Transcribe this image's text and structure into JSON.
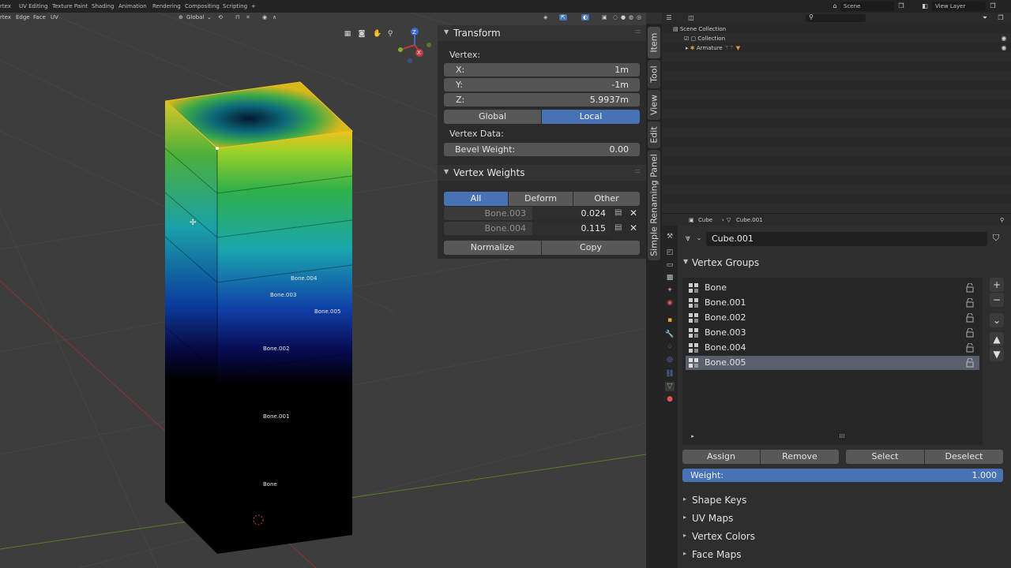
{
  "topbar": {
    "workspaces": [
      "rtex",
      "UV Editing",
      "Texture Paint",
      "Shading",
      "Animation",
      "Rendering",
      "Compositing",
      "Scripting",
      "+"
    ],
    "scene": "Scene",
    "view_layer": "View Layer"
  },
  "viewport_header": {
    "menus": [
      "rtex",
      "Edge",
      "Face",
      "UV"
    ],
    "orientation": "Global"
  },
  "gizmo": {
    "x": "X",
    "y": "Y",
    "z": "Z"
  },
  "bone_labels": [
    "Bone.004",
    "Bone.003",
    "Bone.005",
    "Bone.002",
    "Bone.001",
    "Bone"
  ],
  "transform": {
    "title": "Transform",
    "vertex_label": "Vertex:",
    "x_label": "X:",
    "x_value": "1m",
    "y_label": "Y:",
    "y_value": "-1m",
    "z_label": "Z:",
    "z_value": "5.9937m",
    "global": "Global",
    "local": "Local",
    "vertex_data_label": "Vertex Data:",
    "bevel_label": "Bevel Weight:",
    "bevel_value": "0.00"
  },
  "vertex_weights": {
    "title": "Vertex Weights",
    "tabs": [
      "All",
      "Deform",
      "Other"
    ],
    "rows": [
      {
        "bone": "Bone.003",
        "value": "0.024"
      },
      {
        "bone": "Bone.004",
        "value": "0.115"
      }
    ],
    "normalize": "Normalize",
    "copy": "Copy"
  },
  "side_tabs": [
    "Item",
    "Tool",
    "View",
    "Edit",
    "Simple Renaming Panel"
  ],
  "outliner": {
    "scene_collection": "Scene Collection",
    "collection": "Collection",
    "armature": "Armature"
  },
  "properties": {
    "breadcrumb_object": "Cube",
    "breadcrumb_data": "Cube.001",
    "mesh_name": "Cube.001",
    "vertex_groups_title": "Vertex Groups",
    "groups": [
      "Bone",
      "Bone.001",
      "Bone.002",
      "Bone.003",
      "Bone.004",
      "Bone.005"
    ],
    "selected_group": "Bone.005",
    "assign": "Assign",
    "remove": "Remove",
    "select": "Select",
    "deselect": "Deselect",
    "weight_label": "Weight:",
    "weight_value": "1.000",
    "weight_fraction": 1.0,
    "collapsed_sections": [
      "Shape Keys",
      "UV Maps",
      "Vertex Colors",
      "Face Maps"
    ]
  },
  "colors": {
    "accent": "#4772b3",
    "panel": "#2b2b2b",
    "viewport": "#3d3d3d"
  }
}
